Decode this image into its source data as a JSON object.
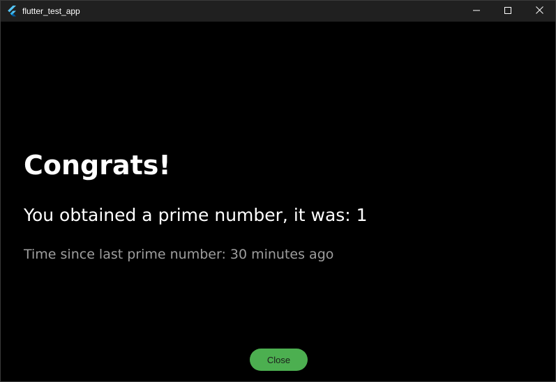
{
  "window": {
    "title": "flutter_test_app",
    "icon": "flutter-logo-icon",
    "controls": {
      "minimize_icon": "minimize-icon",
      "maximize_icon": "maximize-icon",
      "close_icon": "close-icon"
    }
  },
  "main": {
    "heading": "Congrats!",
    "prime_message": "You obtained a prime number, it was: 1",
    "time_message": "Time since last prime number: 30 minutes ago",
    "close_label": "Close"
  },
  "colors": {
    "background": "#000000",
    "titlebar": "#202020",
    "primary_text": "#ffffff",
    "secondary_text": "#9e9e9e",
    "button_bg": "#4caf50",
    "button_text": "#1b1b1b"
  }
}
